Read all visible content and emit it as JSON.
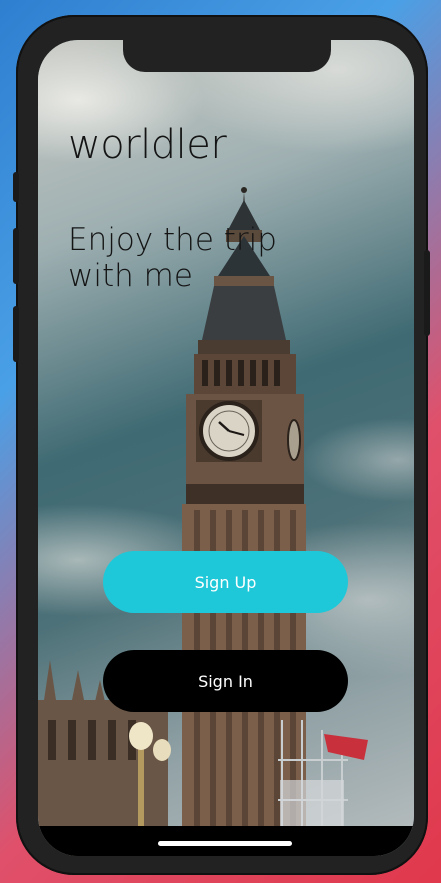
{
  "app": {
    "brand": "worldler",
    "tagline_line1": "Enjoy the trip",
    "tagline_line2": "with me"
  },
  "actions": {
    "sign_up_label": "Sign Up",
    "sign_in_label": "Sign In"
  },
  "colors": {
    "sign_up_bg": "#1ec8d8",
    "sign_in_bg": "#000000",
    "text_dark": "#141414"
  },
  "icons": {
    "background": "big-ben-photo"
  }
}
